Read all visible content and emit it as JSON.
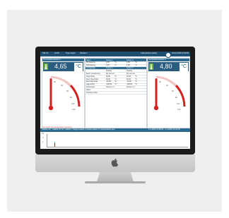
{
  "header": {
    "items": [
      "Tijd: 8u",
      "Lid 0L",
      "Type inspec",
      "Revisie 1"
    ],
    "right_text": "Laboratorium status",
    "datetime": "01-01-2020 12:00:00"
  },
  "left_panel": {
    "title": "Temperatuursensor 1",
    "value": "4,65",
    "unit": "°C"
  },
  "right_panel": {
    "title": "Temperatuursensor 2",
    "value": "4,80",
    "unit": "°C"
  },
  "gauge_labels": [
    "0",
    "20",
    "40",
    "60",
    "80",
    "100",
    "120"
  ],
  "middle_panel": {
    "header": [
      "Naam",
      "Sensor 1",
      "Sensor 2"
    ],
    "rows": [
      [
        "Procestemp.",
        "4,65",
        "°C",
        "4,80",
        "°C"
      ],
      [
        "Ruimtetemp.",
        "4,65",
        "°C",
        "4,80",
        "°C"
      ],
      [
        "Configuratie",
        "Sensor 1",
        "",
        "Sensor 2",
        ""
      ],
      [
        "",
        "Koeling",
        "",
        "Koeling",
        ""
      ],
      [
        "Eenh. omrekening",
        "[G] niet act.",
        "",
        "[G] niet act.",
        ""
      ],
      [
        "Hoge limiet",
        "30,00",
        "°C",
        "30,00",
        "°C"
      ],
      [
        "Zeer hoge limiet",
        "40,00",
        "°C",
        "40,00",
        "°C"
      ],
      [
        "Zeer lage limiet",
        "-30,00",
        "°C",
        "-30,00",
        "°C"
      ],
      [
        "Lage limiet",
        "-100,00",
        "°C",
        "-100,00",
        "°C"
      ],
      [
        "Sensortype",
        "Sensor 1-1",
        "",
        "Sensor 1-2",
        ""
      ],
      [
        "Alarm",
        "",
        "",
        "",
        ""
      ],
      [
        "Koeling modus",
        "",
        "",
        "",
        ""
      ]
    ]
  },
  "bottom": {
    "section_title": "Overzicht van temperatuur sensoren",
    "tabs": [
      "Laatste uur",
      "Laatste 24 uur",
      "Laatste 7 dagen",
      "Laatste 4 weken",
      "Laatste 3 maand",
      "Laatste jaar"
    ],
    "range_text": "1-1-2020 14:09:00 - 1-1-2020 14:10:00",
    "y_labels": [
      "6,5",
      "5",
      "4"
    ]
  },
  "colors": {
    "header": "#1f4f70",
    "panel_blue": "#2b5d80",
    "alert": "#d9534f",
    "gauge_red": "#cc2222"
  }
}
